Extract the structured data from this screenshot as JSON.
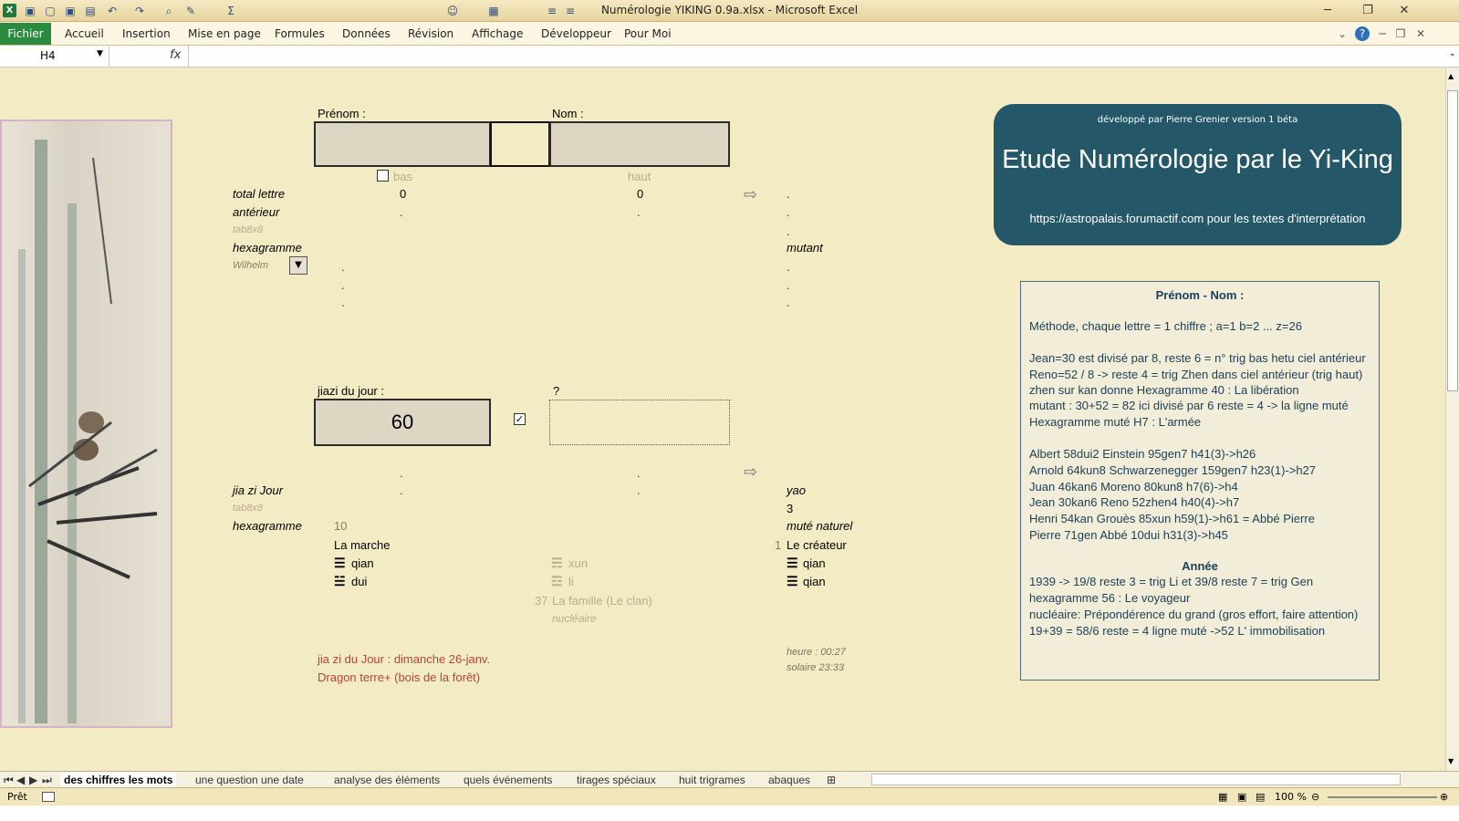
{
  "window": {
    "title": "Numérologie YIKING 0.9a.xlsx  -  Microsoft Excel"
  },
  "ribbon": {
    "tabs": [
      "Fichier",
      "Accueil",
      "Insertion",
      "Mise en page",
      "Formules",
      "Données",
      "Révision",
      "Affichage",
      "Développeur",
      "Pour Moi"
    ]
  },
  "formula_bar": {
    "name_box": "H4",
    "fx_label": "fx",
    "content": ""
  },
  "sheet": {
    "prenom_label": "Prénom :",
    "nom_label": "Nom :",
    "bas_label": "bas",
    "haut_label": "haut",
    "total_lettre_label": "total lettre",
    "total_left": "0",
    "total_right": "0",
    "anterieur_label": "antérieur",
    "tab8x8_label": "tab8x8",
    "hexagramme_label": "hexagramme",
    "mutant_label": "mutant",
    "wilhelm_label": "Wilhelm",
    "dot": ".",
    "jiazi_label": "jiazi du jour :",
    "jiazi_value": "60",
    "question_label": "?",
    "jiazi_jour_label": "jia zi  Jour",
    "yao_label": "yao",
    "tab8x8_2_label": "tab8x8",
    "yao_value": "3",
    "hexagramme2_label": "hexagramme",
    "hex_number": "10",
    "mute_naturel_label": "muté naturel",
    "hex_name": "La marche",
    "mute_index": "1",
    "mute_name": "Le créateur",
    "trigram_top_left": "qian",
    "trigram_bottom_left": "dui",
    "trigram_top_mid": "xun",
    "trigram_bottom_mid": "li",
    "trigram_top_right": "qian",
    "trigram_bottom_right": "qian",
    "nucleaire_number": "37",
    "nucleaire_name": "La famille (Le clan)",
    "nucleaire_label": "nucléaire",
    "jiazi_date": "jia zi du Jour : dimanche 26-janv.",
    "dragon": "Dragon terre+ (bois de la forêt)",
    "heure": "heure : 00:27",
    "solaire": "solaire 23:33"
  },
  "banner": {
    "subtitle": "développé par Pierre Grenier version 1 béta",
    "title": "Etude Numérologie par le Yi-King",
    "url": "https://astropalais.forumactif.com  pour les textes d'interprétation"
  },
  "infobox": {
    "heading": "Prénom - Nom :",
    "lines": [
      "Méthode, chaque lettre = 1 chiffre ;  a=1 b=2 ... z=26",
      "Jean=30 est divisé par 8, reste 6 = n° trig bas hetu ciel antérieur",
      "Reno=52 / 8 -> reste 4 = trig Zhen dans ciel antérieur (trig haut)",
      "zhen sur kan donne Hexagramme 40 : La  libération",
      "mutant : 30+52  = 82 ici divisé par 6 reste = 4 -> la ligne muté",
      "Hexagramme muté  H7 : L'armée",
      "Albert 58dui2 Einstein 95gen7                 h41(3)->h26",
      "Arnold 64kun8 Schwarzenegger 159gen7  h23(1)->h27",
      "Juan 46kan6 Moreno 80kun8 h7(6)->h4",
      "Jean 30kan6 Reno 52zhen4      h40(4)->h7",
      "Henri 54kan  Grouès 85xun  h59(1)->h61 = Abbé Pierre",
      "Pierre 71gen Abbé 10dui     h31(3)->h45"
    ],
    "heading2": "Année",
    "lines2": [
      "1939  -> 19/8 reste 3 = trig Li et 39/8  reste  7 = trig Gen",
      "hexagramme  56 : Le voyageur",
      "nucléaire: Prépondérence du grand (gros effort, faire attention)",
      "19+39  = 58/6 reste = 4 ligne muté ->52 L' immobilisation"
    ]
  },
  "sheet_tabs": [
    "des chiffres les mots",
    "une question une date",
    "analyse des éléments",
    "quels événements",
    "tirages spéciaux",
    "huit trigrames",
    "abaques"
  ],
  "status": {
    "ready": "Prêt",
    "zoom": "100 %"
  },
  "colors": {
    "sheet_bg": "#f3ebc4",
    "banner_bg": "#245868",
    "fichier_green": "#2a8a3e",
    "text_red": "#b0463b"
  }
}
